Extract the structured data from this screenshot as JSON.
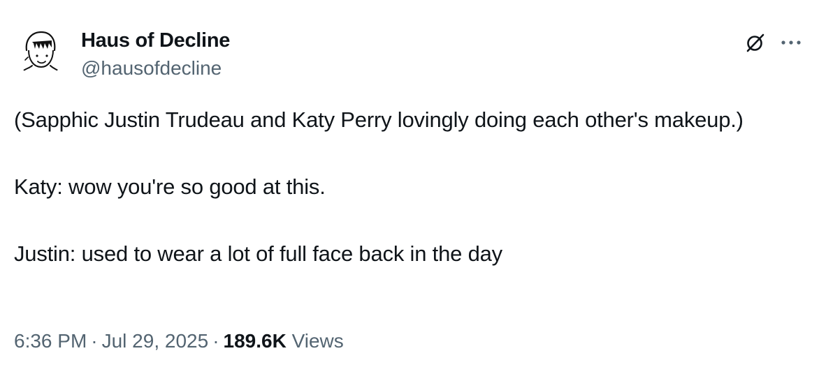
{
  "author": {
    "display_name": "Haus of Decline",
    "handle": "@hausofdecline",
    "avatar_icon": "line-drawing-face-avatar"
  },
  "actions": {
    "grok_icon": "grok-icon",
    "more_icon": "more-dots-icon"
  },
  "tweet": {
    "paragraphs": [
      "(Sapphic Justin Trudeau and Katy Perry lovingly doing each other's makeup.)",
      "Katy: wow you're so good at this.",
      "Justin: used to wear a lot of full face back in the day"
    ]
  },
  "meta": {
    "time": "6:36 PM",
    "separator": "·",
    "date": "Jul 29, 2025",
    "views_count": "189.6K",
    "views_label": "Views"
  },
  "colors": {
    "text_primary": "#0f1419",
    "text_secondary": "#536471",
    "background": "#ffffff"
  }
}
